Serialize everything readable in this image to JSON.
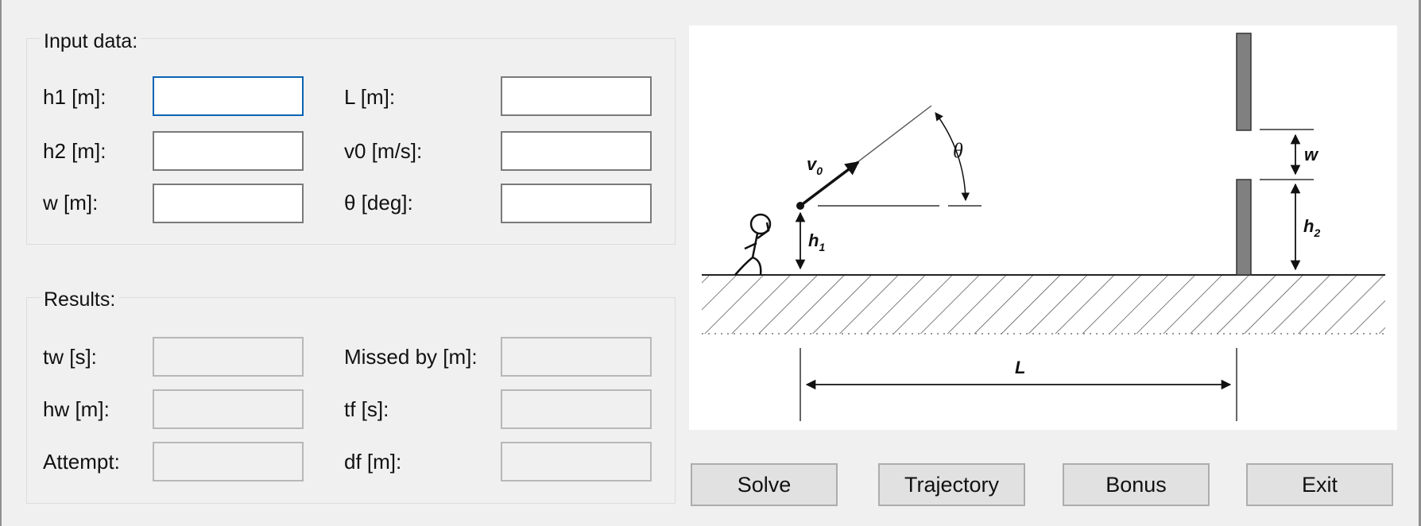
{
  "input_group": {
    "title": "Input data:",
    "h1_label": "h1 [m]:",
    "h2_label": "h2 [m]:",
    "w_label": "w [m]:",
    "L_label": "L [m]:",
    "v0_label": "v0 [m/s]:",
    "theta_label": "θ [deg]:",
    "h1_value": "",
    "h2_value": "",
    "w_value": "",
    "L_value": "",
    "v0_value": "",
    "theta_value": ""
  },
  "results_group": {
    "title": "Results:",
    "tw_label": "tw [s]:",
    "hw_label": "hw [m]:",
    "attempt_label": "Attempt:",
    "missed_label": "Missed by [m]:",
    "tf_label": "tf [s]:",
    "df_label": "df [m]:",
    "tw_value": "",
    "hw_value": "",
    "attempt_value": "",
    "missed_value": "",
    "tf_value": "",
    "df_value": ""
  },
  "diagram": {
    "v0_label": "v",
    "v0_sub": "0",
    "theta_label": "θ",
    "h1_label": "h",
    "h1_sub": "1",
    "h2_label": "h",
    "h2_sub": "2",
    "w_label": "w",
    "L_label": "L"
  },
  "buttons": {
    "solve": "Solve",
    "trajectory": "Trajectory",
    "bonus": "Bonus",
    "exit": "Exit"
  },
  "colors": {
    "window_bg": "#f0f0f0",
    "focus_border": "#0a64b4",
    "wall": "#808080"
  }
}
